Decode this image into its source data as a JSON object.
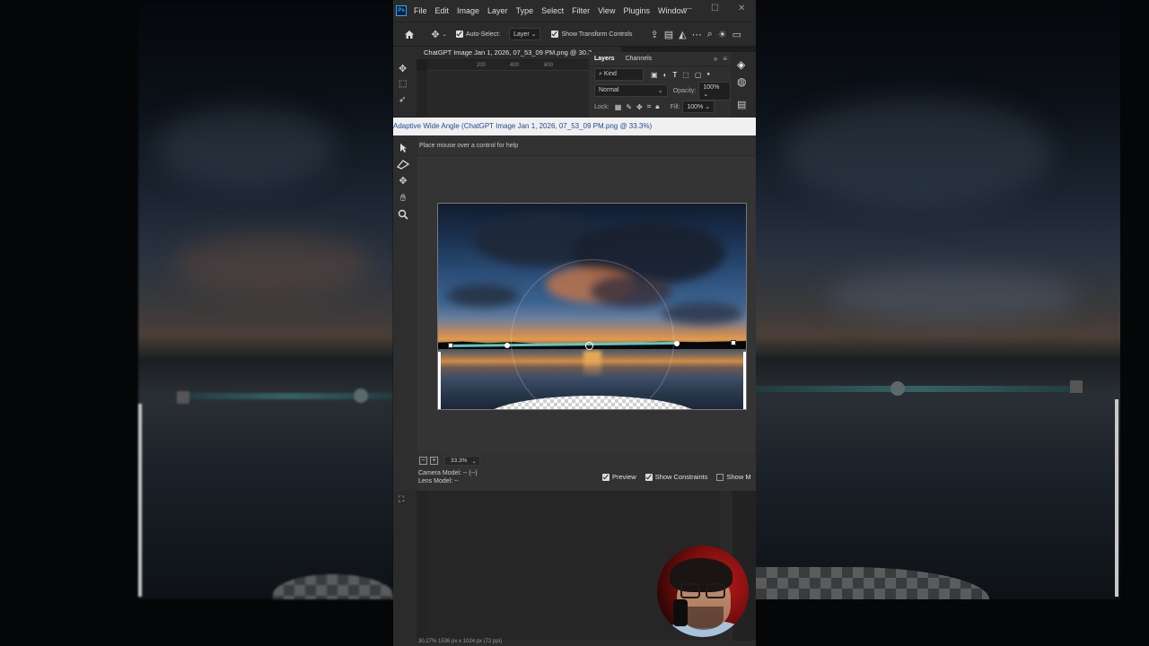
{
  "app": {
    "logo": "Ps",
    "menus": [
      "File",
      "Edit",
      "Image",
      "Layer",
      "Type",
      "Select",
      "Filter",
      "View",
      "Plugins",
      "Window"
    ],
    "window_controls": [
      "minimize-icon",
      "maximize-icon",
      "close-icon"
    ]
  },
  "options_bar": {
    "auto_select_label": "Auto-Select:",
    "auto_select_checked": true,
    "auto_select_target": "Layer",
    "show_transform_label": "Show Transform Controls",
    "show_transform_checked": true
  },
  "document": {
    "tab_title": "ChatGPT Image Jan 1, 2026, 07_53_09 PM.png @ 30.3",
    "ruler_marks": [
      "200",
      "400",
      "600"
    ]
  },
  "layers_panel": {
    "tabs": [
      "Layers",
      "Channels"
    ],
    "active_tab": "Layers",
    "filter_label": "Kind",
    "blend_mode": "Normal",
    "opacity_label": "Opacity:",
    "opacity_value": "100%",
    "lock_label": "Lock:",
    "fill_label": "Fill:",
    "fill_value": "100%"
  },
  "dialog": {
    "title": "Adaptive Wide Angle (ChatGPT Image Jan 1, 2026, 07_53_09 PM.png @ 33.3%)",
    "help_text": "Place mouse over a control for help",
    "tools": [
      "constraint-tool-icon",
      "polygon-constraint-tool-icon",
      "move-tool-icon",
      "hand-tool-icon",
      "zoom-tool-icon"
    ],
    "zoom_value": "33.3%",
    "camera_model_label": "Camera Model: -- (--)",
    "lens_model_label": "Lens Model: --",
    "options": [
      {
        "label": "Preview",
        "checked": true
      },
      {
        "label": "Show Constraints",
        "checked": true
      },
      {
        "label": "Show M",
        "checked": false
      }
    ]
  },
  "statusbar": {
    "text": "30.27%    1536 px x 1024 px (72 ppi)"
  },
  "colors": {
    "constraint_line": "#5fc7c3",
    "dialog_title_text": "#1e4a9a",
    "panel_bg": "#2f2f2f",
    "ps_blue": "#31a8ff"
  }
}
